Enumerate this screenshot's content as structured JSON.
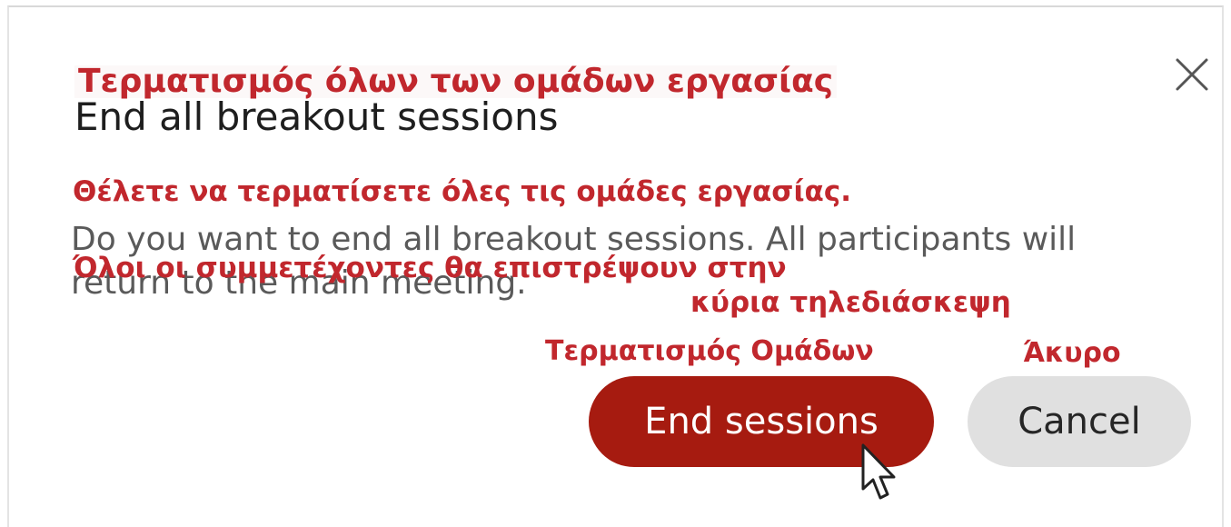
{
  "dialog": {
    "title": "End all breakout sessions",
    "message": "Do you want to end all breakout sessions. All participants will return to the main meeting.",
    "close_icon": "close-icon",
    "end_button_label": "End sessions",
    "cancel_button_label": "Cancel",
    "accent_color": "#a61b10"
  },
  "annotations": {
    "title_gr": "Τερματισμός όλων των ομάδων εργασίας",
    "message_line1_gr": "Θέλετε να τερματίσετε όλες τις ομάδες εργασίας.",
    "message_line2_gr": "Όλοι οι συμμετέχοντες θα επιστρέψουν στην",
    "message_line3_gr": "κύρια τηλεδιάσκεψη",
    "end_button_gr": "Τερματισμός Ομάδων",
    "cancel_button_gr": "Άκυρο",
    "color": "#c1272d"
  },
  "cursor_icon": "mouse-pointer-icon"
}
